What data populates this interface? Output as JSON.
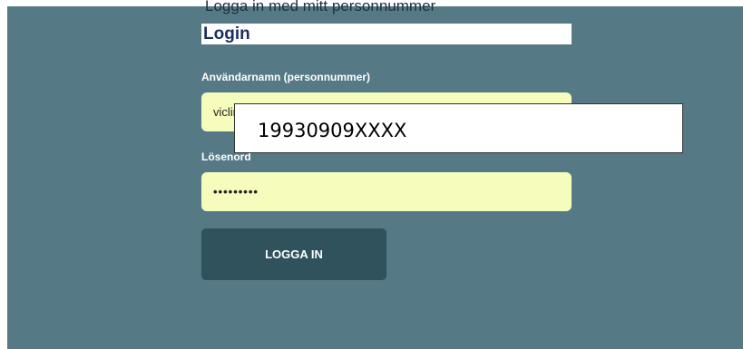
{
  "header": {
    "cut_off_text": "Logga in med mitt personnummer"
  },
  "form": {
    "title": "Login",
    "username_label": "Användarnamn (personnummer)",
    "username_value": "viclin",
    "password_label": "Lösenord",
    "password_value": "•••••••••",
    "submit_label": "LOGGA IN"
  },
  "overlay": {
    "text": "19930909XXXX"
  },
  "colors": {
    "panel_background": "#557985",
    "input_background": "#f5fcbc",
    "button_background": "#2f525d",
    "title_color": "#1b2f5e"
  }
}
